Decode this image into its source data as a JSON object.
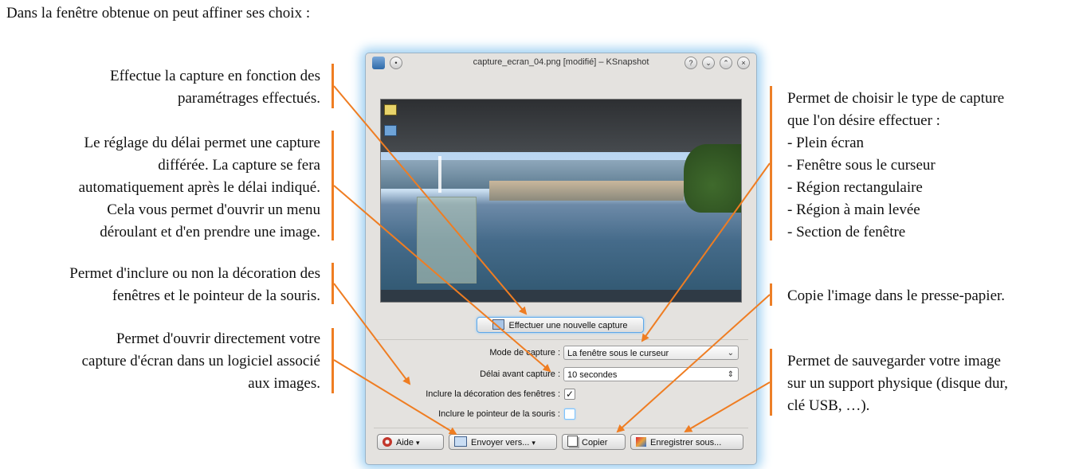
{
  "intro": "Dans la fenêtre obtenue on peut affiner ses choix :",
  "left_notes": [
    [
      "Effectue la capture en fonction des",
      "paramétrages effectués."
    ],
    [
      "Le réglage du délai permet une capture",
      "différée. La capture se fera",
      "automatiquement après le délai indiqué.",
      "Cela vous permet d'ouvrir un menu",
      "déroulant et d'en prendre une image."
    ],
    [
      "Permet d'inclure ou non la décoration des",
      "fenêtres et le pointeur de la souris."
    ],
    [
      "Permet d'ouvrir directement votre",
      "capture d'écran dans un logiciel associé",
      "aux images."
    ]
  ],
  "right_notes": [
    [
      "Permet de choisir le type de capture",
      "que l'on désire effectuer :",
      "- Plein écran",
      "- Fenêtre sous le curseur",
      "- Région rectangulaire",
      "- Région à main levée",
      "- Section de fenêtre"
    ],
    [
      "Copie l'image dans le presse-papier."
    ],
    [
      "Permet de sauvegarder votre image",
      "sur un support physique (disque dur,",
      "clé USB, …)."
    ]
  ],
  "window": {
    "title": "capture_ecran_04.png [modifié] – KSnapshot",
    "capture_button": "Effectuer une nouvelle capture",
    "mode_label": "Mode de capture :",
    "mode_value": "La fenêtre sous le curseur",
    "delay_label": "Délai avant capture :",
    "delay_value": "10 secondes",
    "decoration_label": "Inclure la décoration des fenêtres :",
    "pointer_label": "Inclure le pointeur de la souris :",
    "help_button": "Aide",
    "send_button": "Envoyer vers...",
    "copy_button": "Copier",
    "save_button": "Enregistrer sous..."
  },
  "controls": {
    "decoration_checked": true,
    "pointer_checked": false
  },
  "colors": {
    "annotation": "#ef7d22",
    "window_glow": "#9fd0f2"
  }
}
